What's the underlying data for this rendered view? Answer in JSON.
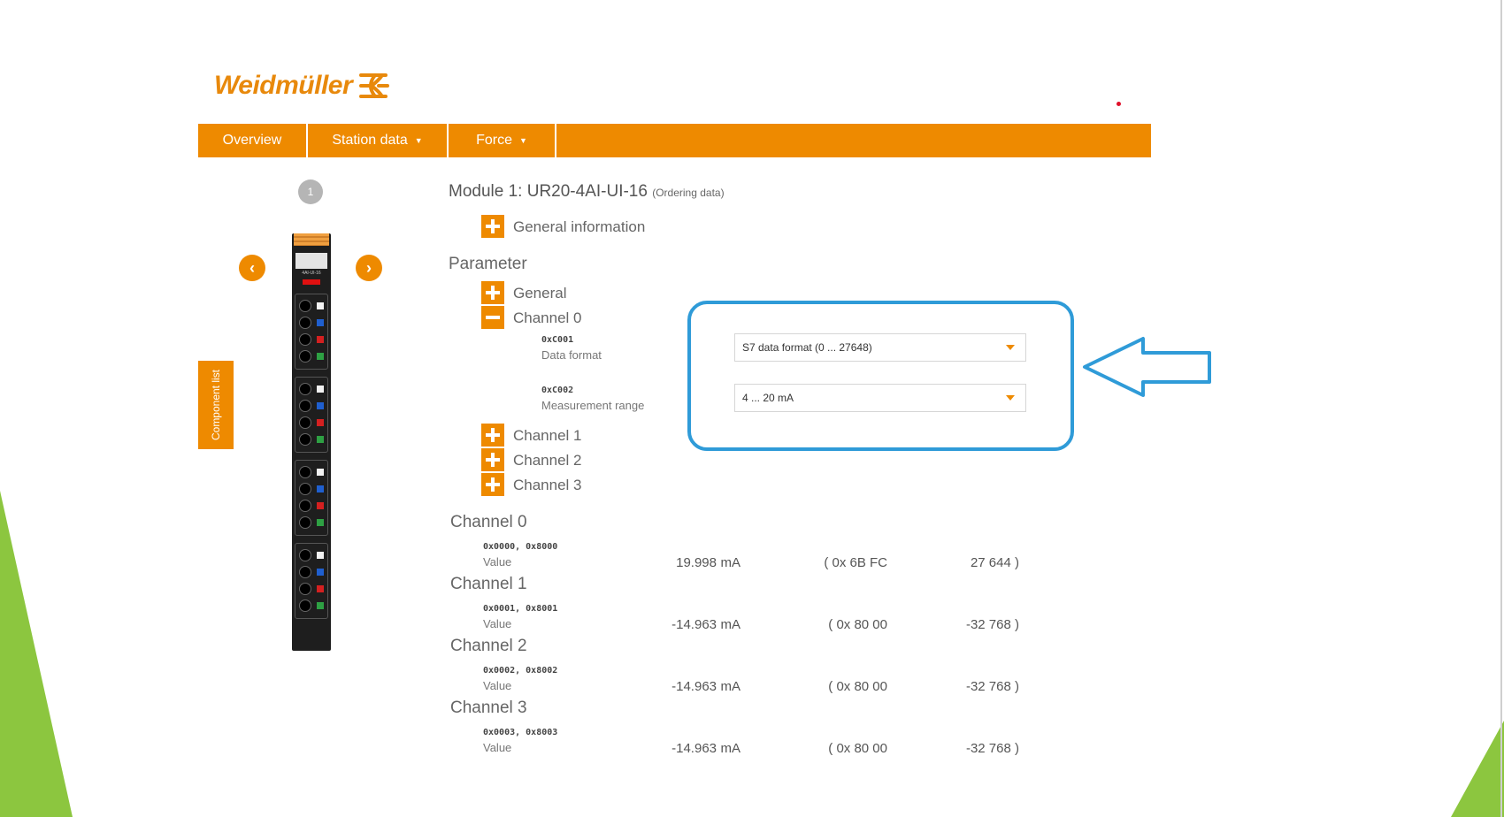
{
  "brand": {
    "logo_text": "Weidmüller",
    "color": "#ee8a00"
  },
  "nav": {
    "items": [
      {
        "label": "Overview",
        "has_caret": false
      },
      {
        "label": "Station data",
        "has_caret": true
      },
      {
        "label": "Force",
        "has_caret": true
      }
    ]
  },
  "sidebar": {
    "component_list_label": "Component list",
    "slot_number": "1"
  },
  "module_graphic": {
    "label": "4AI-UI-16"
  },
  "module": {
    "title": "Module 1: UR20-4AI-UI-16",
    "ordering_link": "(Ordering data)",
    "general_information": "General information"
  },
  "parameter": {
    "heading": "Parameter",
    "general": "General",
    "channel0": "Channel 0",
    "data_format": {
      "index": "0xC001",
      "label": "Data format",
      "value": "S7 data format (0 ... 27648)"
    },
    "measurement_range": {
      "index": "0xC002",
      "label": "Measurement range",
      "value": "4 ... 20 mA"
    },
    "channels_collapsed": [
      "Channel 1",
      "Channel 2",
      "Channel 3"
    ]
  },
  "process_data": [
    {
      "heading": "Channel 0",
      "index": "0x0000, 0x8000",
      "label": "Value",
      "value": "19.998",
      "unit": "mA",
      "hex_open": "( 0x 6B FC",
      "decimal": "27 644 )"
    },
    {
      "heading": "Channel 1",
      "index": "0x0001, 0x8001",
      "label": "Value",
      "value": "-14.963",
      "unit": "mA",
      "hex_open": "( 0x 80 00",
      "decimal": "-32 768 )"
    },
    {
      "heading": "Channel 2",
      "index": "0x0002, 0x8002",
      "label": "Value",
      "value": "-14.963",
      "unit": "mA",
      "hex_open": "( 0x 80 00",
      "decimal": "-32 768 )"
    },
    {
      "heading": "Channel 3",
      "index": "0x0003, 0x8003",
      "label": "Value",
      "value": "-14.963",
      "unit": "mA",
      "hex_open": "( 0x 80 00",
      "decimal": "-32 768 )"
    }
  ],
  "colors": {
    "highlight": "#2f9bd8",
    "accent_green": "#8cc63f"
  }
}
